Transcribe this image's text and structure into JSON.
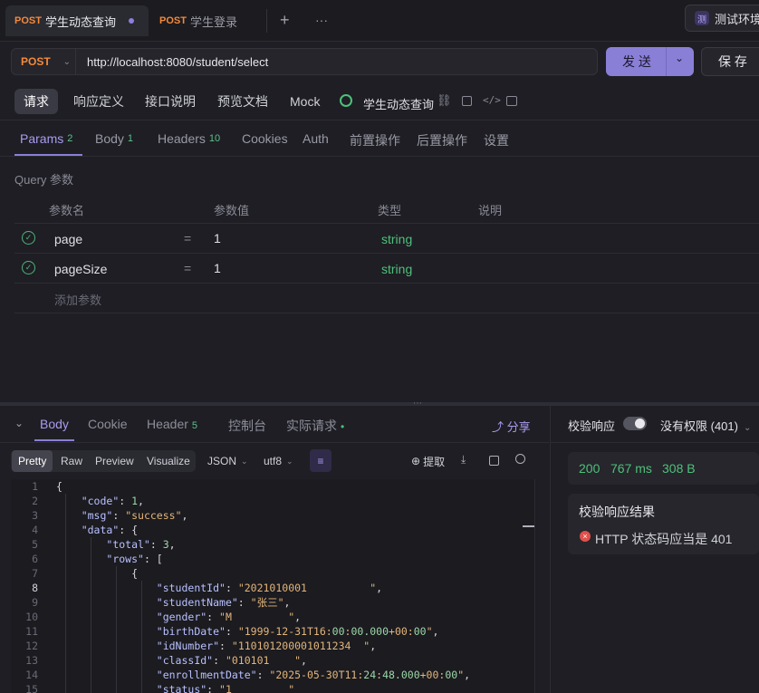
{
  "tabs": [
    {
      "method": "POST",
      "label": "学生动态查询",
      "active": true
    },
    {
      "method": "POST",
      "label": "学生登录",
      "active": false
    }
  ],
  "tab_add_icon": "+",
  "tab_more_icon": "···",
  "env": {
    "icon_text": "测",
    "label": "测试环境"
  },
  "request": {
    "method": "POST",
    "url": "http://localhost:8080/student/select",
    "send_label": "发 送",
    "save_label": "保 存"
  },
  "sub_tabs": [
    "请求",
    "响应定义",
    "接口说明",
    "预览文档",
    "Mock"
  ],
  "api_name": "学生动态查询",
  "param_tabs": [
    {
      "label": "Params",
      "badge": "2"
    },
    {
      "label": "Body",
      "badge": "1"
    },
    {
      "label": "Headers",
      "badge": "10"
    },
    {
      "label": "Cookies",
      "badge": ""
    },
    {
      "label": "Auth",
      "badge": ""
    },
    {
      "label": "前置操作",
      "badge": ""
    },
    {
      "label": "后置操作",
      "badge": ""
    },
    {
      "label": "设置",
      "badge": ""
    }
  ],
  "query": {
    "section_title": "Query 参数",
    "headers": [
      "参数名",
      "参数值",
      "类型",
      "说明"
    ],
    "rows": [
      {
        "name": "page",
        "eq": "=",
        "value": "1",
        "type": "string"
      },
      {
        "name": "pageSize",
        "eq": "=",
        "value": "1",
        "type": "string"
      }
    ],
    "add_placeholder": "添加参数"
  },
  "response": {
    "tabs": [
      {
        "label": "Body",
        "badge": ""
      },
      {
        "label": "Cookie",
        "badge": ""
      },
      {
        "label": "Header",
        "badge": "5"
      },
      {
        "label": "控制台",
        "badge": ""
      },
      {
        "label": "实际请求",
        "badge": "•"
      }
    ],
    "share_label": "分享",
    "view_modes": [
      "Pretty",
      "Raw",
      "Preview",
      "Visualize"
    ],
    "format": "JSON",
    "encoding": "utf8",
    "extract_label": "提取",
    "code_lines": [
      {
        "n": "1",
        "t": "{"
      },
      {
        "n": "2",
        "t": "    \"code\": 1,"
      },
      {
        "n": "3",
        "t": "    \"msg\": \"success\","
      },
      {
        "n": "4",
        "t": "    \"data\": {"
      },
      {
        "n": "5",
        "t": "        \"total\": 3,"
      },
      {
        "n": "6",
        "t": "        \"rows\": ["
      },
      {
        "n": "7",
        "t": "            {"
      },
      {
        "n": "8",
        "t": "                \"studentId\": \"2021010001          \","
      },
      {
        "n": "9",
        "t": "                \"studentName\": \"张三\","
      },
      {
        "n": "10",
        "t": "                \"gender\": \"M         \","
      },
      {
        "n": "11",
        "t": "                \"birthDate\": \"1999-12-31T16:00:00.000+00:00\","
      },
      {
        "n": "12",
        "t": "                \"idNumber\": \"110101200001011234  \","
      },
      {
        "n": "13",
        "t": "                \"classId\": \"010101    \","
      },
      {
        "n": "14",
        "t": "                \"enrollmentDate\": \"2025-05-30T11:24:48.000+00:00\","
      },
      {
        "n": "15",
        "t": "                \"status\": \"1         \""
      }
    ]
  },
  "validation": {
    "label": "校验响应",
    "permission": "没有权限 (401)",
    "status": "200",
    "time": "767 ms",
    "size": "308 B",
    "result_title": "校验响应结果",
    "result_msg": "HTTP 状态码应当是 401"
  }
}
